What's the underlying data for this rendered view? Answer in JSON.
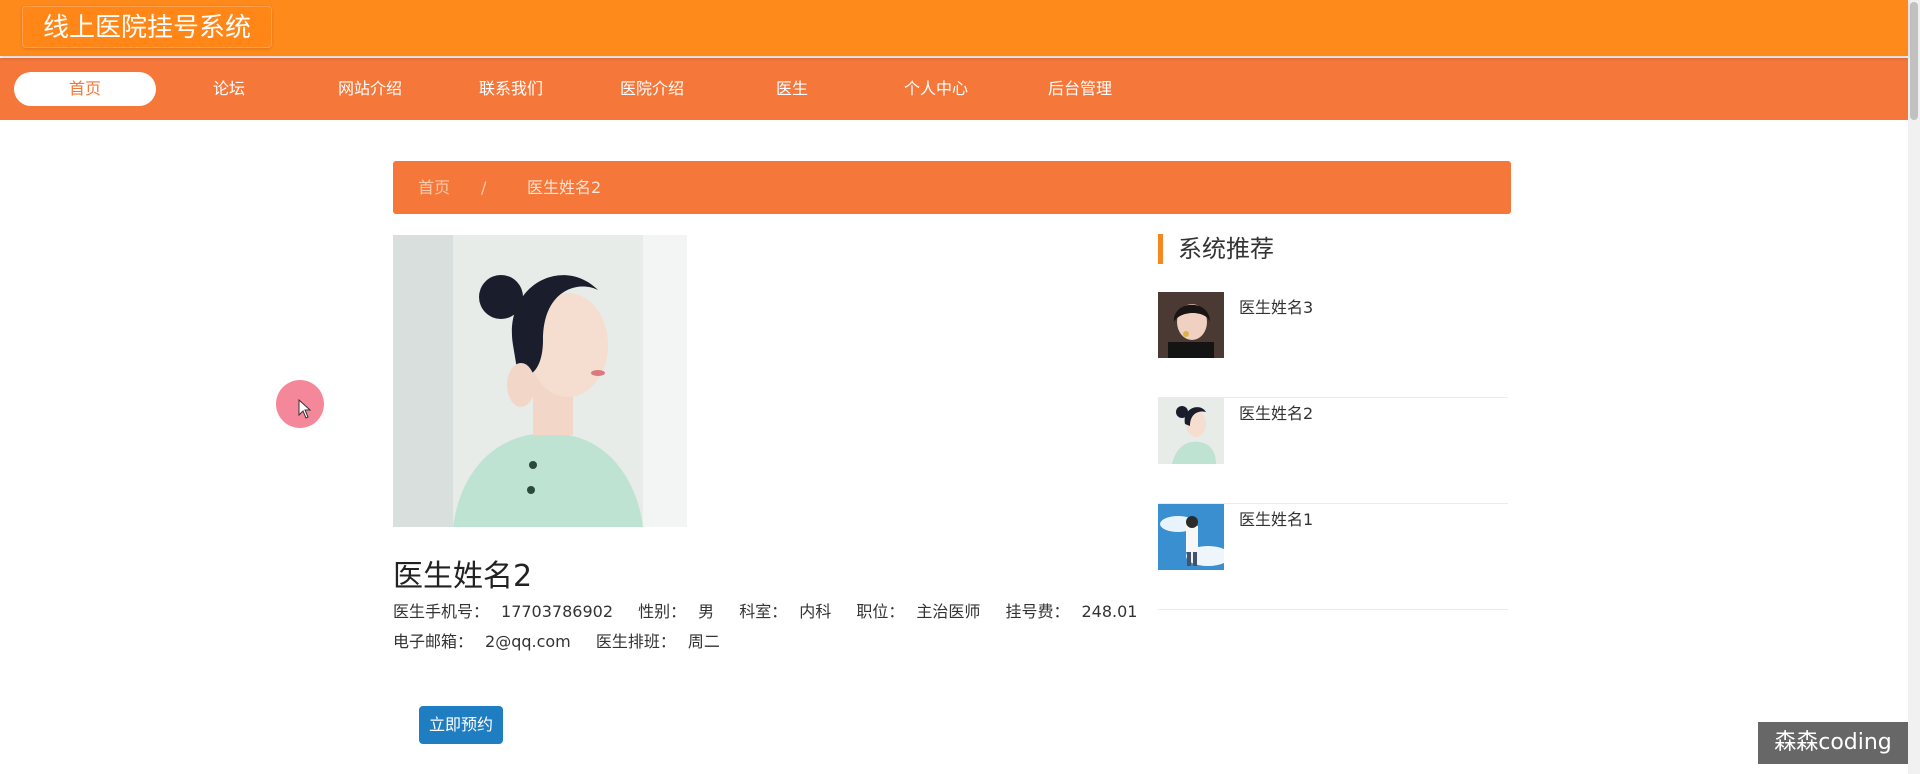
{
  "header": {
    "logo_text": "线上医院挂号系统"
  },
  "nav": {
    "items": [
      {
        "label": "首页",
        "active": true
      },
      {
        "label": "论坛"
      },
      {
        "label": "网站介绍"
      },
      {
        "label": "联系我们"
      },
      {
        "label": "医院介绍"
      },
      {
        "label": "医生"
      },
      {
        "label": "个人中心"
      },
      {
        "label": "后台管理"
      }
    ]
  },
  "breadcrumb": {
    "home": "首页",
    "separator": "/",
    "current": "医生姓名2"
  },
  "doctor": {
    "name": "医生姓名2",
    "phone_label": "医生手机号：",
    "phone": "17703786902",
    "gender_label": "性别：",
    "gender": "男",
    "dept_label": "科室：",
    "dept": "内科",
    "position_label": "职位：",
    "position": "主治医师",
    "fee_label": "挂号费：",
    "fee": "248.01",
    "email_label": "电子邮箱：",
    "email": "2@qq.com",
    "schedule_label": "医生排班：",
    "schedule": "周二",
    "book_button": "立即预约"
  },
  "sidebar": {
    "title": "系统推荐",
    "items": [
      {
        "name": "医生姓名3"
      },
      {
        "name": "医生姓名2"
      },
      {
        "name": "医生姓名1"
      }
    ]
  },
  "watermark": "森森coding",
  "colors": {
    "header_orange": "#ff8a1c",
    "nav_orange": "#f6773a",
    "button_blue": "#1f7ec2"
  }
}
